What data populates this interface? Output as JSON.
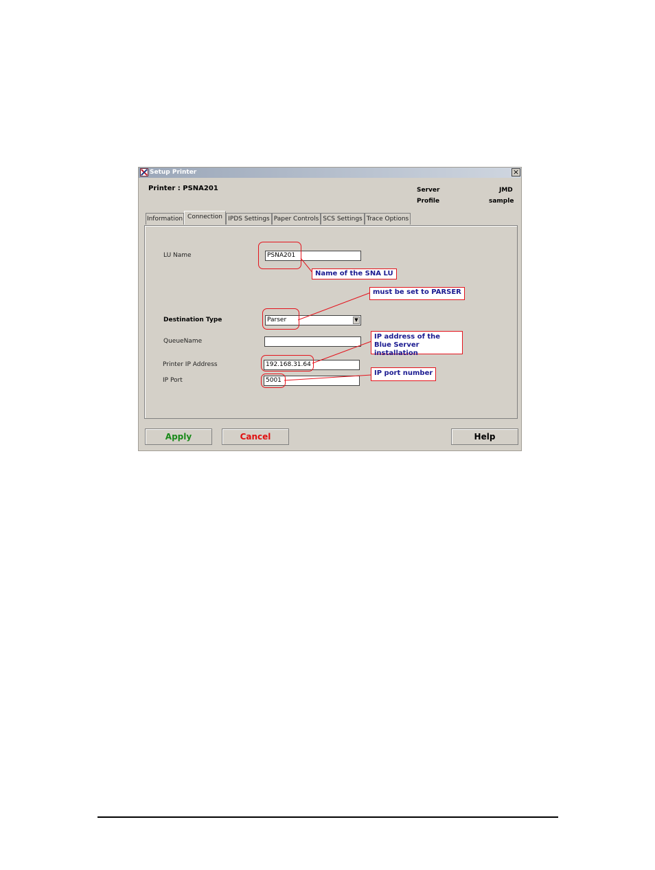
{
  "window": {
    "title": "Setup Printer",
    "close_symbol": "×",
    "icon": "app-flag-icon"
  },
  "header": {
    "printer_label": "Printer : PSNA201",
    "server_label": "Server",
    "server_value": "JMD",
    "profile_label": "Profile",
    "profile_value": "sample"
  },
  "tabs": [
    {
      "label": "Information",
      "active": false
    },
    {
      "label": "Connection",
      "active": true
    },
    {
      "label": "IPDS Settings",
      "active": false
    },
    {
      "label": "Paper Controls",
      "active": false
    },
    {
      "label": "SCS Settings",
      "active": false
    },
    {
      "label": "Trace Options",
      "active": false
    }
  ],
  "form": {
    "lu_name": {
      "label": "LU Name",
      "value": "PSNA201"
    },
    "destination_type": {
      "label": "Destination Type",
      "value": "Parser"
    },
    "queue_name": {
      "label": "QueueName",
      "value": ""
    },
    "printer_ip": {
      "label": "Printer IP Address",
      "value": "192.168.31.64"
    },
    "ip_port": {
      "label": "IP Port",
      "value": "5001"
    }
  },
  "buttons": {
    "apply": "Apply",
    "cancel": "Cancel",
    "help": "Help"
  },
  "callouts": {
    "lu": "Name of the SNA LU",
    "parser": "must be set to PARSER",
    "ip_line1": "IP address of the",
    "ip_line2": "Blue Server installation",
    "port": "IP port number"
  },
  "colors": {
    "annotation_red": "#e4121b",
    "annotation_text": "#1a1a90",
    "apply_green": "#1a8a1a",
    "cancel_red": "#e01010"
  }
}
